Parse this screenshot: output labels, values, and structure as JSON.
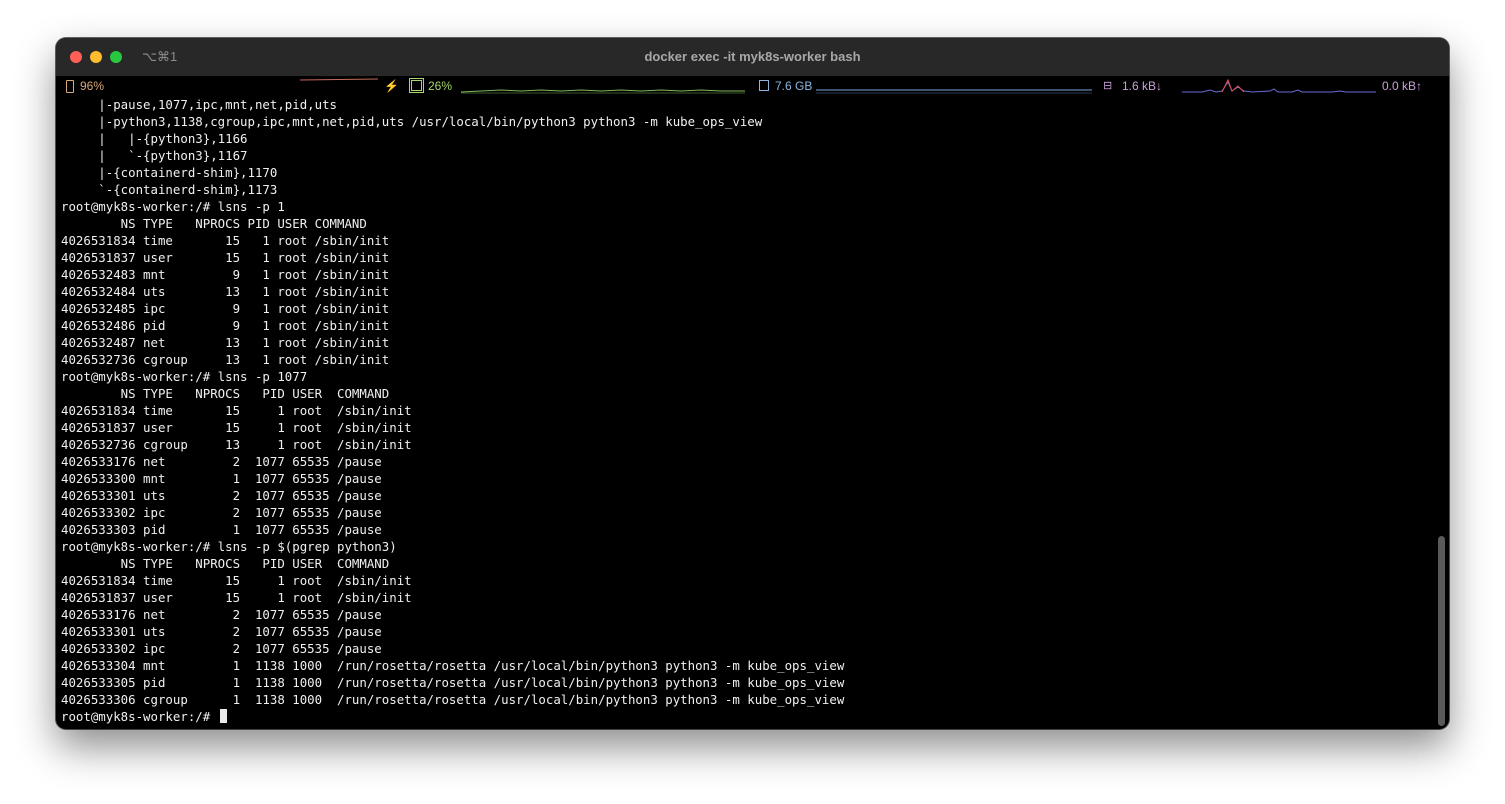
{
  "window": {
    "shortcut": "⌥⌘1",
    "title": "docker exec -it myk8s-worker bash"
  },
  "statusbar": {
    "battery": "96%",
    "charging_icon": "⚡",
    "cpu": "26%",
    "memory": "7.6 GB",
    "net_icon": "⊟",
    "net_down": "1.6 kB↓",
    "net_up": "0.0 kB↑"
  },
  "terminal": {
    "lines": [
      "     |-pause,1077,ipc,mnt,net,pid,uts",
      "     |-python3,1138,cgroup,ipc,mnt,net,pid,uts /usr/local/bin/python3 python3 -m kube_ops_view",
      "     |   |-{python3},1166",
      "     |   `-{python3},1167",
      "     |-{containerd-shim},1170",
      "     `-{containerd-shim},1173",
      "root@myk8s-worker:/# lsns -p 1",
      "        NS TYPE   NPROCS PID USER COMMAND",
      "4026531834 time       15   1 root /sbin/init",
      "4026531837 user       15   1 root /sbin/init",
      "4026532483 mnt         9   1 root /sbin/init",
      "4026532484 uts        13   1 root /sbin/init",
      "4026532485 ipc         9   1 root /sbin/init",
      "4026532486 pid         9   1 root /sbin/init",
      "4026532487 net        13   1 root /sbin/init",
      "4026532736 cgroup     13   1 root /sbin/init",
      "root@myk8s-worker:/# lsns -p 1077",
      "        NS TYPE   NPROCS   PID USER  COMMAND",
      "4026531834 time       15     1 root  /sbin/init",
      "4026531837 user       15     1 root  /sbin/init",
      "4026532736 cgroup     13     1 root  /sbin/init",
      "4026533176 net         2  1077 65535 /pause",
      "4026533300 mnt         1  1077 65535 /pause",
      "4026533301 uts         2  1077 65535 /pause",
      "4026533302 ipc         2  1077 65535 /pause",
      "4026533303 pid         1  1077 65535 /pause",
      "root@myk8s-worker:/# lsns -p $(pgrep python3)",
      "        NS TYPE   NPROCS   PID USER  COMMAND",
      "4026531834 time       15     1 root  /sbin/init",
      "4026531837 user       15     1 root  /sbin/init",
      "4026533176 net         2  1077 65535 /pause",
      "4026533301 uts         2  1077 65535 /pause",
      "4026533302 ipc         2  1077 65535 /pause",
      "4026533304 mnt         1  1138 1000  /run/rosetta/rosetta /usr/local/bin/python3 python3 -m kube_ops_view",
      "4026533305 pid         1  1138 1000  /run/rosetta/rosetta /usr/local/bin/python3 python3 -m kube_ops_view",
      "4026533306 cgroup      1  1138 1000  /run/rosetta/rosetta /usr/local/bin/python3 python3 -m kube_ops_view"
    ],
    "prompt": "root@myk8s-worker:/# "
  },
  "colors": {
    "battery": "#d8a878",
    "cpu": "#a6d96a",
    "memory": "#8ab6e0",
    "network": "#c8a0d8",
    "network_spike": "#e05050"
  }
}
